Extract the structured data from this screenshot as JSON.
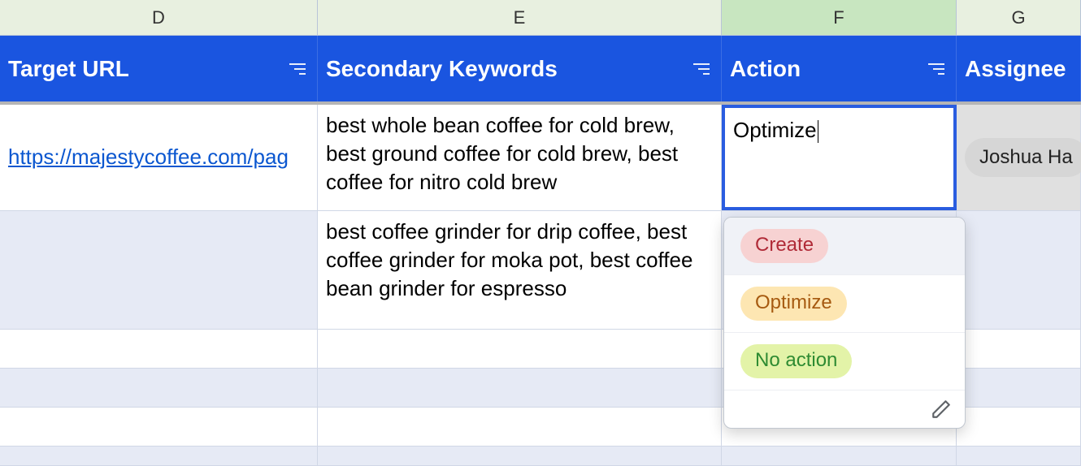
{
  "columns": {
    "d": {
      "letter": "D",
      "header": "Target URL"
    },
    "e": {
      "letter": "E",
      "header": "Secondary Keywords"
    },
    "f": {
      "letter": "F",
      "header": "Action"
    },
    "g": {
      "letter": "G",
      "header": "Assignee"
    }
  },
  "rows": [
    {
      "url": "https://majestycoffee.com/pag",
      "keywords": "best whole bean coffee for cold brew, best ground coffee for cold brew, best coffee for nitro cold brew",
      "action": "Optimize",
      "assignee": "Joshua Ha"
    },
    {
      "url": "",
      "keywords": "best coffee grinder for drip coffee, best coffee grinder for moka pot, best coffee bean grinder for espresso",
      "action": "",
      "assignee": ""
    }
  ],
  "dropdown": {
    "options": [
      {
        "label": "Create",
        "style": "create"
      },
      {
        "label": "Optimize",
        "style": "optimize"
      },
      {
        "label": "No action",
        "style": "noaction"
      }
    ]
  }
}
